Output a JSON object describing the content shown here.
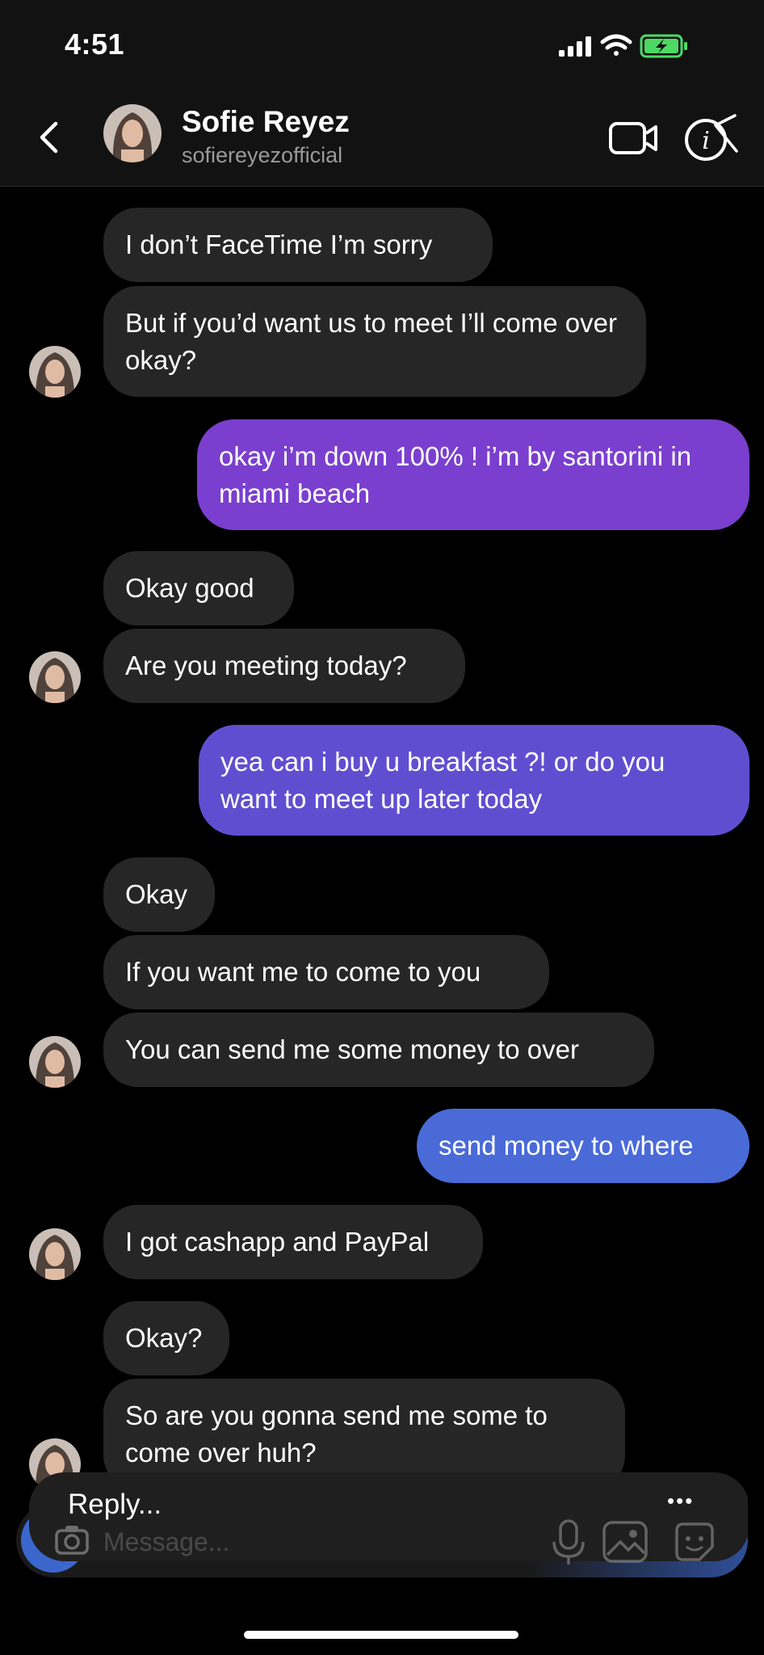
{
  "status": {
    "time": "4:51"
  },
  "header": {
    "name": "Sofie Reyez",
    "username": "sofiereyezofficial"
  },
  "messages": [
    {
      "text": "I don’t FaceTime I’m sorry"
    },
    {
      "text": "But if you’d want us to meet I’ll come over okay?"
    },
    {
      "text": "okay i’m down 100% ! i’m by santorini in miami beach"
    },
    {
      "text": "Okay good"
    },
    {
      "text": "Are you meeting today?"
    },
    {
      "text": "yea can i buy u breakfast ?! or do you want to meet up later today"
    },
    {
      "text": "Okay"
    },
    {
      "text": "If you want me to come to you"
    },
    {
      "text": "You can send me some money to over"
    },
    {
      "text": "send money to where"
    },
    {
      "text": "I got cashapp and PayPal"
    },
    {
      "text": "Okay?"
    },
    {
      "text": "So are you gonna send me some to come over huh?"
    }
  ],
  "composer": {
    "reply_label": "Reply...",
    "message_placeholder": "Message...",
    "more_label": "•••"
  },
  "colors": {
    "incoming": "#262626",
    "outgoing_top": "#7a3fce",
    "outgoing_mid": "#5f4fd0",
    "outgoing_bottom": "#4a6ad8"
  }
}
